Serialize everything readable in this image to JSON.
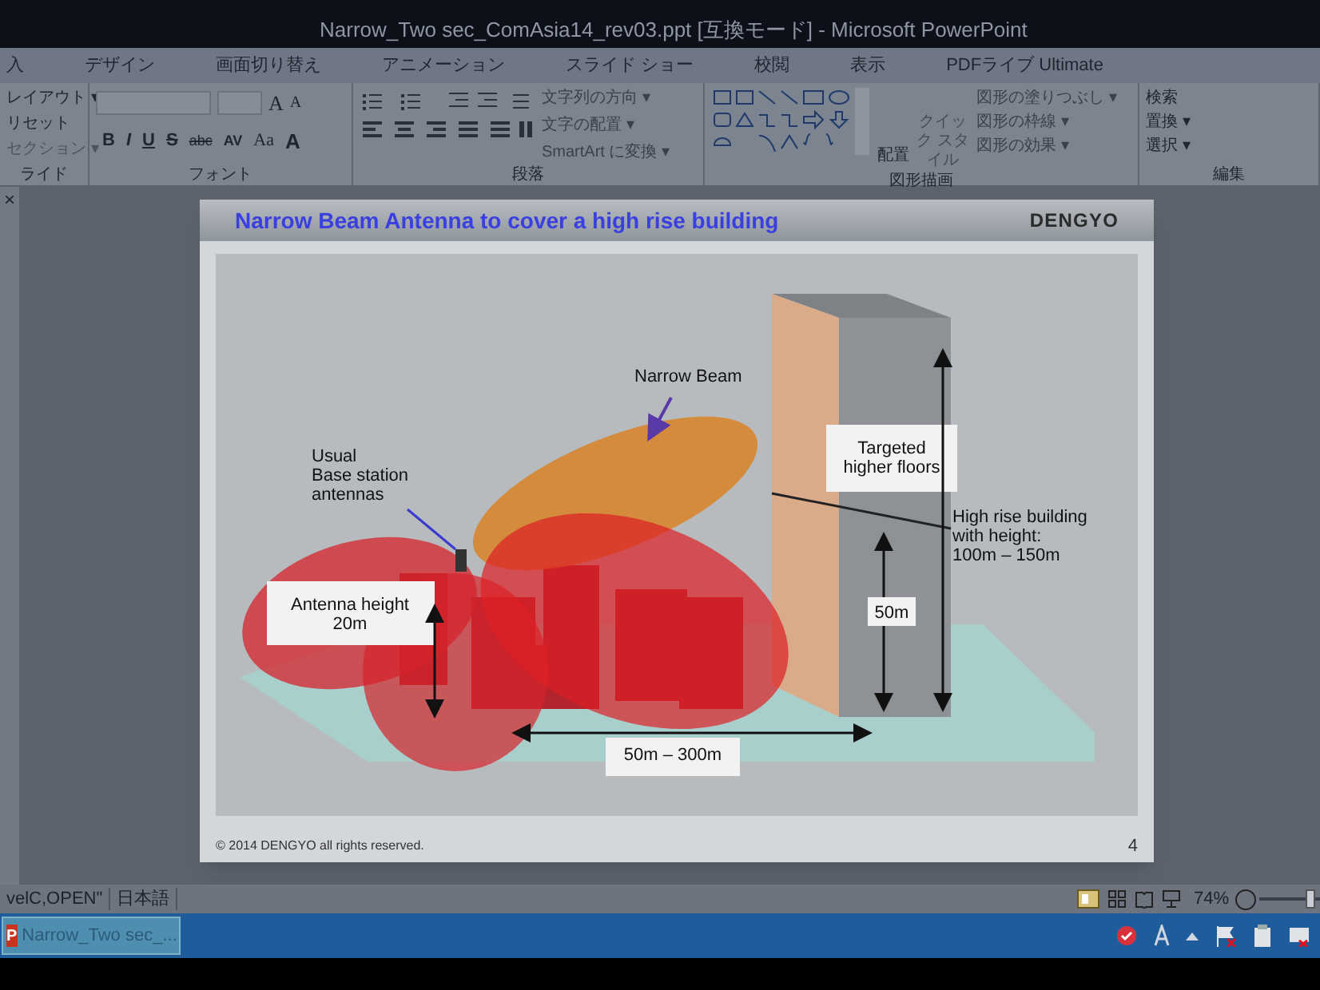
{
  "window": {
    "title": "Narrow_Two sec_ComAsia14_rev03.ppt [互換モード] - Microsoft PowerPoint"
  },
  "ribbon_tabs": [
    {
      "label": "入"
    },
    {
      "label": "デザイン"
    },
    {
      "label": "画面切り替え"
    },
    {
      "label": "アニメーション"
    },
    {
      "label": "スライド ショー"
    },
    {
      "label": "校閲"
    },
    {
      "label": "表示"
    },
    {
      "label": "PDFライブ Ultimate"
    }
  ],
  "slides_group": {
    "commands": [
      "レイアウト ▾",
      "リセット",
      "セクション ▾"
    ],
    "label": "ライド"
  },
  "font_group": {
    "buttons": [
      "B",
      "I",
      "U",
      "S",
      "abc",
      "AV",
      "Aa",
      "A"
    ],
    "size_buttons": [
      "A",
      "A"
    ],
    "label": "フォント"
  },
  "paragraph_group": {
    "commands": [
      "文字列の方向 ▾",
      "文字の配置 ▾",
      "SmartArt に変換 ▾"
    ],
    "label": "段落"
  },
  "drawing_group": {
    "arrange": "配置",
    "quick_style": "クイック スタイル",
    "commands": [
      "図形の塗りつぶし ▾",
      "図形の枠線 ▾",
      "図形の効果 ▾"
    ],
    "label": "図形描画"
  },
  "editing_group": {
    "commands": [
      "検索",
      "置換 ▾",
      "選択 ▾"
    ],
    "label": "編集"
  },
  "left_panel": {
    "close": "×"
  },
  "slide": {
    "title": "Narrow Beam Antenna to cover a high rise building",
    "logo": "DENGYO",
    "labels": {
      "narrow_beam": "Narrow Beam",
      "usual_antennas": [
        "Usual",
        "Base station",
        "antennas"
      ],
      "antenna_height": [
        "Antenna height",
        "20m"
      ],
      "targeted": [
        "Targeted",
        "higher floors"
      ],
      "high_rise": [
        "High rise building",
        "with height:",
        "100m – 150m"
      ],
      "floors_height": "50m",
      "distance": "50m – 300m"
    },
    "footer": "© 2014 DENGYO all rights reserved.",
    "page_number": "4"
  },
  "status_bar": {
    "items": [
      "velC,OPEN\"",
      "日本語"
    ],
    "zoom": "74%",
    "zoom_slider": {
      "level": 0.85
    }
  },
  "taskbar": {
    "app_letter": "P",
    "window_button": "Narrow_Two sec_..."
  }
}
